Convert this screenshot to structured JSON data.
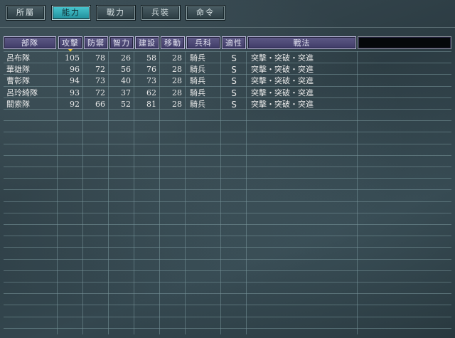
{
  "tabs": [
    {
      "label": "所屬",
      "active": false
    },
    {
      "label": "能力",
      "active": true
    },
    {
      "label": "戰力",
      "active": false
    },
    {
      "label": "兵裝",
      "active": false
    },
    {
      "label": "命令",
      "active": false
    }
  ],
  "headers": {
    "unit": "部隊",
    "attack": "攻擊",
    "defense": "防禦",
    "intellect": "智力",
    "construct": "建設",
    "move": "移動",
    "troop_type": "兵科",
    "aptitude": "適性",
    "tactics": "戰法"
  },
  "sort_indicator_column": "attack",
  "rows": [
    {
      "unit": "呂布隊",
      "attack": "105",
      "defense": "78",
      "intellect": "26",
      "construct": "58",
      "move": "28",
      "troop_type": "騎兵",
      "aptitude": "S",
      "tactics": "突擊・突破・突進"
    },
    {
      "unit": "華雄隊",
      "attack": "96",
      "defense": "72",
      "intellect": "56",
      "construct": "76",
      "move": "28",
      "troop_type": "騎兵",
      "aptitude": "S",
      "tactics": "突擊・突破・突進"
    },
    {
      "unit": "曹彰隊",
      "attack": "94",
      "defense": "73",
      "intellect": "40",
      "construct": "73",
      "move": "28",
      "troop_type": "騎兵",
      "aptitude": "S",
      "tactics": "突擊・突破・突進"
    },
    {
      "unit": "呂玲綺隊",
      "attack": "93",
      "defense": "72",
      "intellect": "37",
      "construct": "62",
      "move": "28",
      "troop_type": "騎兵",
      "aptitude": "S",
      "tactics": "突擊・突破・突進"
    },
    {
      "unit": "關索隊",
      "attack": "92",
      "defense": "66",
      "intellect": "52",
      "construct": "81",
      "move": "28",
      "troop_type": "騎兵",
      "aptitude": "S",
      "tactics": "突擊・突破・突進"
    }
  ],
  "colors": {
    "active_tab": "#2fb1bb",
    "header_bg": "#4e4a78",
    "sort_marker": "#e8c431"
  }
}
